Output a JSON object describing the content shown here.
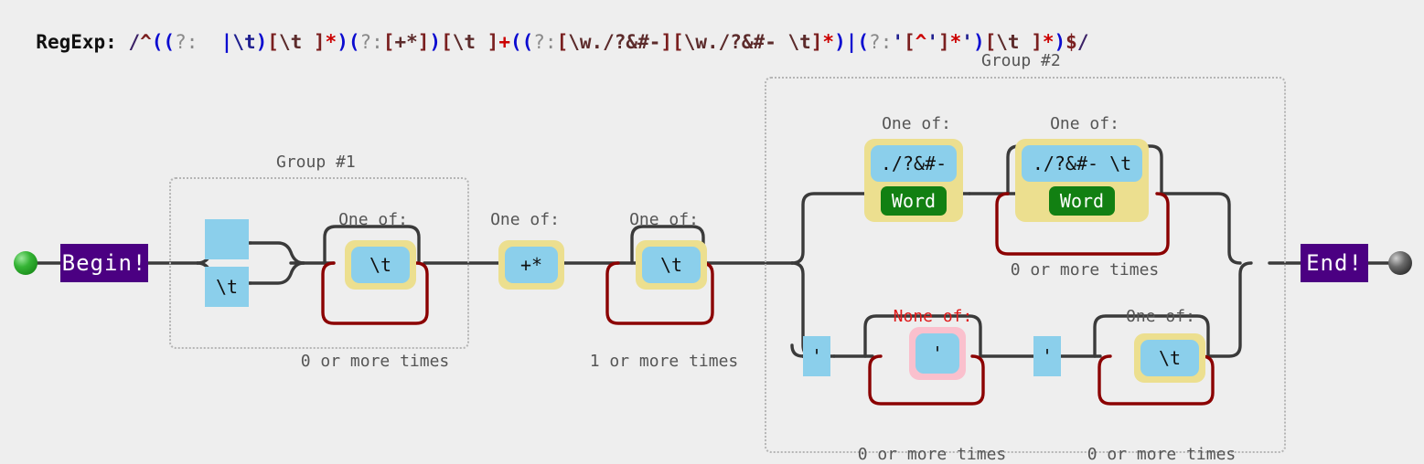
{
  "header": {
    "label": "RegExp:",
    "pattern": "/^((?:  |\\t)[\\t ]*)(?:[+*])[\\t ]+((?:[\\w./?&#-][\\w./?&#- \\t]*)|(?:'[^']*')[\\t ]*)$/",
    "tokens": [
      {
        "t": "/",
        "c": "tk-slash"
      },
      {
        "t": "^",
        "c": "tk-anchor"
      },
      {
        "t": "((",
        "c": "tk-paren"
      },
      {
        "t": "?:",
        "c": "tk-ncg"
      },
      {
        "t": "  ",
        "c": "tk-lit"
      },
      {
        "t": "|",
        "c": "tk-alt"
      },
      {
        "t": "\\t",
        "c": "tk-lit"
      },
      {
        "t": ")",
        "c": "tk-paren"
      },
      {
        "t": "[",
        "c": "tk-brk"
      },
      {
        "t": "\\t ",
        "c": "tk-cls"
      },
      {
        "t": "]",
        "c": "tk-brk"
      },
      {
        "t": "*",
        "c": "tk-quant"
      },
      {
        "t": ")",
        "c": "tk-paren"
      },
      {
        "t": "(",
        "c": "tk-paren"
      },
      {
        "t": "?:",
        "c": "tk-ncg"
      },
      {
        "t": "[",
        "c": "tk-brk"
      },
      {
        "t": "+*",
        "c": "tk-cls"
      },
      {
        "t": "]",
        "c": "tk-brk"
      },
      {
        "t": ")",
        "c": "tk-paren"
      },
      {
        "t": "[",
        "c": "tk-brk"
      },
      {
        "t": "\\t ",
        "c": "tk-cls"
      },
      {
        "t": "]",
        "c": "tk-brk"
      },
      {
        "t": "+",
        "c": "tk-plus"
      },
      {
        "t": "((",
        "c": "tk-paren"
      },
      {
        "t": "?:",
        "c": "tk-ncg"
      },
      {
        "t": "[",
        "c": "tk-brk"
      },
      {
        "t": "\\w./?&#-",
        "c": "tk-cls"
      },
      {
        "t": "]",
        "c": "tk-brk"
      },
      {
        "t": "[",
        "c": "tk-brk"
      },
      {
        "t": "\\w./?&#- \\t",
        "c": "tk-cls"
      },
      {
        "t": "]",
        "c": "tk-brk"
      },
      {
        "t": "*",
        "c": "tk-quant"
      },
      {
        "t": ")",
        "c": "tk-paren"
      },
      {
        "t": "|",
        "c": "tk-alt"
      },
      {
        "t": "(",
        "c": "tk-paren"
      },
      {
        "t": "?:",
        "c": "tk-ncg"
      },
      {
        "t": "'",
        "c": "tk-quote"
      },
      {
        "t": "[",
        "c": "tk-brk"
      },
      {
        "t": "^",
        "c": "tk-caret"
      },
      {
        "t": "'",
        "c": "tk-quote"
      },
      {
        "t": "]",
        "c": "tk-brk"
      },
      {
        "t": "*",
        "c": "tk-quant"
      },
      {
        "t": "'",
        "c": "tk-quote"
      },
      {
        "t": ")",
        "c": "tk-paren"
      },
      {
        "t": "[",
        "c": "tk-brk"
      },
      {
        "t": "\\t ",
        "c": "tk-cls"
      },
      {
        "t": "]",
        "c": "tk-brk"
      },
      {
        "t": "*",
        "c": "tk-quant"
      },
      {
        "t": ")",
        "c": "tk-paren"
      },
      {
        "t": "$",
        "c": "tk-anchor"
      },
      {
        "t": "/",
        "c": "tk-slash"
      }
    ]
  },
  "terminals": {
    "begin_label": "Begin!",
    "end_label": "End!"
  },
  "groups": [
    {
      "id": "group1",
      "title": "Group #1"
    },
    {
      "id": "group2",
      "title": "Group #2"
    }
  ],
  "captions": {
    "one_of": "One of:",
    "none_of": "None of:",
    "zero_or_more": "0 or more times",
    "one_or_more": "1 or more times"
  },
  "nodes": {
    "g1_alt_top": {
      "text": " "
    },
    "g1_alt_bottom": {
      "text": "\\t"
    },
    "g1_class": {
      "label": "One of:",
      "chars": "\\t ",
      "quant": "0 or more times"
    },
    "plusstar": {
      "label": "One of:",
      "chars": "+*"
    },
    "tabspace": {
      "label": "One of:",
      "chars": "\\t ",
      "quant": "1 or more times"
    },
    "g2_word_first": {
      "label": "One of:",
      "chars": "./?&#-",
      "word": "Word"
    },
    "g2_word_rest": {
      "label": "One of:",
      "chars": "./?&#- \\t",
      "word": "Word",
      "quant": "0 or more times"
    },
    "quote_open": {
      "text": "'"
    },
    "not_quote": {
      "label": "None of:",
      "chars": "'",
      "quant": "0 or more times"
    },
    "quote_close": {
      "text": "'"
    },
    "g2_trail": {
      "label": "One of:",
      "chars": "\\t ",
      "quant": "0 or more times"
    }
  },
  "colors": {
    "background": "#eeeeee",
    "wire": "#3a3a3a",
    "quantifier_loop": "#8b0000",
    "literal_blue": "#8bcfeb",
    "one_of_yellow": "#ecdf8f",
    "none_of_pink": "#fac0cd",
    "word_green": "#128012",
    "terminal_purple": "#4b0082",
    "group_border": "#b5b5b5"
  }
}
